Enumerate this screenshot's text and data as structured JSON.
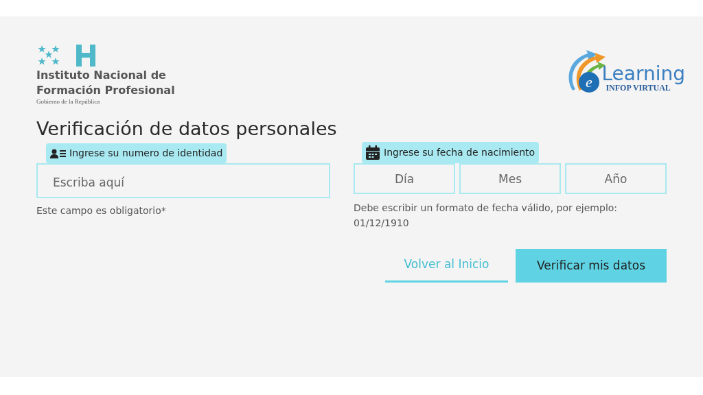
{
  "header": {
    "institute_logo": {
      "lines": [
        "Instituto Nacional de",
        "Formación Profesional"
      ],
      "subtitle": "Gobierno de la República"
    },
    "elearning_logo": {
      "letter": "e",
      "word": "Learning",
      "subtitle": "INFOP VIRTUAL"
    }
  },
  "title": "Verificación de datos personales",
  "identity": {
    "label": "Ingrese su numero de identidad",
    "placeholder": "Escriba aquí",
    "help": "Este campo es obligatorio*"
  },
  "birthdate": {
    "label": "Ingrese su fecha de nacimiento",
    "fields": [
      {
        "placeholder": "Día"
      },
      {
        "placeholder": "Mes"
      },
      {
        "placeholder": "Año"
      }
    ],
    "help": "Debe escribir un formato de fecha válido, por ejemplo: 01/12/1910"
  },
  "buttons": [
    {
      "kind": "link",
      "label": "Volver al Inicio"
    },
    {
      "kind": "primary",
      "label": "Verificar mis datos"
    }
  ]
}
